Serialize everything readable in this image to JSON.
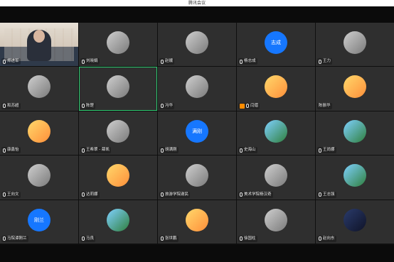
{
  "window": {
    "title": "腾讯会议"
  },
  "participants": [
    {
      "name": "郑进军",
      "type": "video",
      "icon": "mic-icon"
    },
    {
      "name": "刘晓娟",
      "type": "photo",
      "icon": "mic-icon"
    },
    {
      "name": "赵娥",
      "type": "photo",
      "icon": "mic-icon"
    },
    {
      "name": "杨志成",
      "type": "initials",
      "initials": "志成",
      "icon": "mic-icon"
    },
    {
      "name": "王力",
      "type": "photo",
      "icon": "mic-icon"
    },
    {
      "name": "和苏超",
      "type": "photo",
      "icon": "mic-icon"
    },
    {
      "name": "陈楚",
      "type": "photo",
      "icon": "mic-icon",
      "active": true
    },
    {
      "name": "冯华",
      "type": "photo",
      "icon": "mic-icon"
    },
    {
      "name": "闫熠",
      "type": "cartoon",
      "icon": "mic-icon",
      "badge": true
    },
    {
      "name": "陈振华",
      "type": "cartoon",
      "icon": "none"
    },
    {
      "name": "康鑫怡",
      "type": "cartoon",
      "icon": "mic-icon"
    },
    {
      "name": "王希翠 - 薛凯",
      "type": "photo",
      "icon": "mic-icon"
    },
    {
      "name": "胡满刚",
      "type": "initials",
      "initials": "满刚",
      "icon": "mic-icon"
    },
    {
      "name": "史海山",
      "type": "nature",
      "icon": "mic-icon"
    },
    {
      "name": "王尚娜",
      "type": "nature",
      "icon": "mic-icon"
    },
    {
      "name": "王向文",
      "type": "photo",
      "icon": "mic-icon"
    },
    {
      "name": "达莉娜",
      "type": "cartoon",
      "icon": "mic-icon"
    },
    {
      "name": "旅游学院谢民",
      "type": "photo",
      "icon": "mic-icon"
    },
    {
      "name": "美术学院杨汉奇",
      "type": "photo",
      "icon": "mic-icon"
    },
    {
      "name": "王志强",
      "type": "nature",
      "icon": "mic-icon"
    },
    {
      "name": "马院谭刚兰",
      "type": "initials",
      "initials": "刚兰",
      "icon": "mic-icon"
    },
    {
      "name": "马良",
      "type": "nature",
      "icon": "mic-icon"
    },
    {
      "name": "张世鹏",
      "type": "cartoon",
      "icon": "mic-icon"
    },
    {
      "name": "徐国柱",
      "type": "photo",
      "icon": "mic-icon"
    },
    {
      "name": "赵向东",
      "type": "dark",
      "icon": "mic-icon"
    }
  ]
}
